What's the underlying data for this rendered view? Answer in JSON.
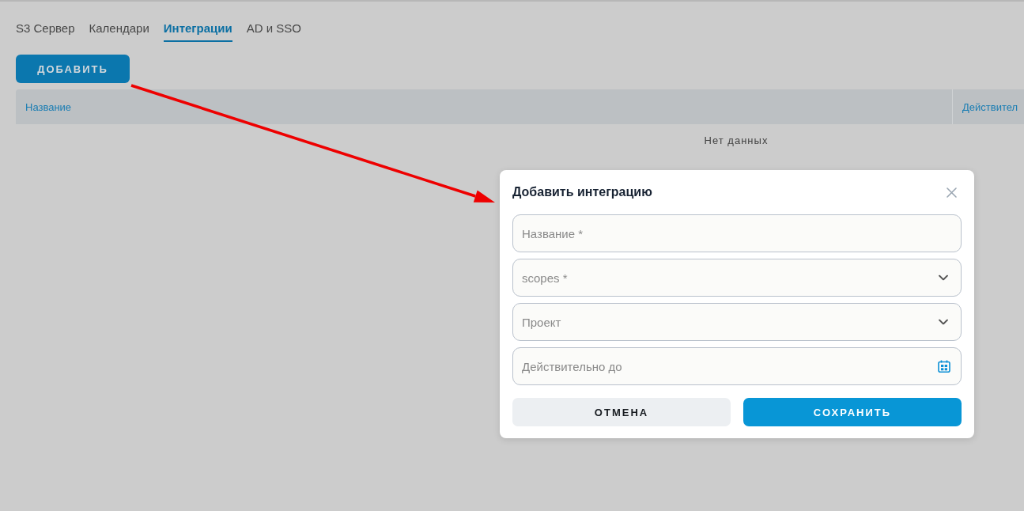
{
  "tabs": [
    {
      "label": "S3 Сервер",
      "selected": false
    },
    {
      "label": "Календари",
      "selected": false
    },
    {
      "label": "Интеграции",
      "selected": true
    },
    {
      "label": "AD и SSO",
      "selected": false
    }
  ],
  "add_button": {
    "label": "ДОБАВИТЬ"
  },
  "table": {
    "columns": [
      "Название",
      "Действител"
    ],
    "empty_text": "Нет данных"
  },
  "dialog": {
    "title": "Добавить интеграцию",
    "fields": [
      {
        "kind": "text",
        "placeholder": "Название *"
      },
      {
        "kind": "select",
        "placeholder": "scopes *"
      },
      {
        "kind": "select",
        "placeholder": "Проект"
      },
      {
        "kind": "date",
        "placeholder": "Действительно до"
      }
    ],
    "buttons": [
      {
        "kind": "secondary",
        "label": "ОТМЕНА"
      },
      {
        "kind": "primary",
        "label": "СОХРАНИТЬ"
      }
    ]
  }
}
